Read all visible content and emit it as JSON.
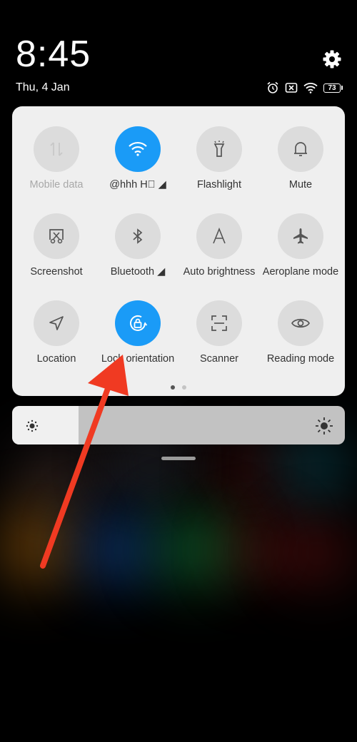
{
  "status_bar": {
    "time": "8:45",
    "date": "Thu, 4 Jan",
    "battery": "73"
  },
  "quick_settings": {
    "tiles": [
      {
        "label": "Mobile data",
        "icon": "mobile-data-icon",
        "active": false,
        "dim": true
      },
      {
        "label": "@hhh          H⃝ ◢",
        "icon": "wifi-icon",
        "active": true,
        "dim": false
      },
      {
        "label": "Flashlight",
        "icon": "flashlight-icon",
        "active": false,
        "dim": false
      },
      {
        "label": "Mute",
        "icon": "bell-icon",
        "active": false,
        "dim": false
      },
      {
        "label": "Screenshot",
        "icon": "screenshot-icon",
        "active": false,
        "dim": false
      },
      {
        "label": "Bluetooth ◢",
        "icon": "bluetooth-icon",
        "active": false,
        "dim": false
      },
      {
        "label": "Auto brightness",
        "icon": "auto-brightness-icon",
        "active": false,
        "dim": false
      },
      {
        "label": "Aeroplane mode",
        "icon": "airplane-icon",
        "active": false,
        "dim": false
      },
      {
        "label": "Location",
        "icon": "location-icon",
        "active": false,
        "dim": false
      },
      {
        "label": "Lock orientation",
        "icon": "rotation-lock-icon",
        "active": true,
        "dim": false
      },
      {
        "label": "Scanner",
        "icon": "scanner-icon",
        "active": false,
        "dim": false
      },
      {
        "label": "Reading mode",
        "icon": "eye-icon",
        "active": false,
        "dim": false
      }
    ],
    "page_count": 2,
    "current_page": 1
  },
  "brightness": {
    "level": 0.2
  },
  "colors": {
    "accent": "#1a9bf7",
    "annotation_arrow": "#f03a22"
  }
}
